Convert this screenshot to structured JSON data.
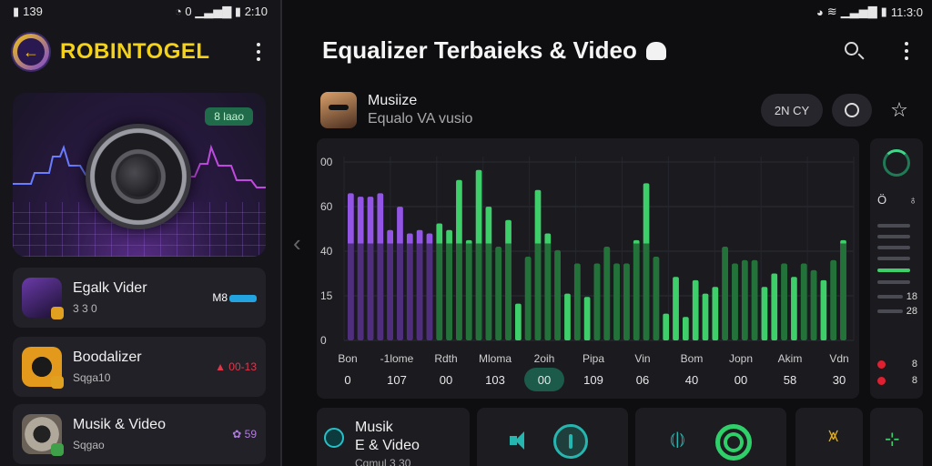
{
  "left": {
    "status": {
      "left_text": "139",
      "right_text": "0",
      "time": "2:10"
    },
    "app_title": "ROBINTOGEL",
    "hero_badge": "8 laao",
    "cards": [
      {
        "title": "Egalk Vider",
        "sub": "3  3  0",
        "meta": "M8",
        "meta_color": "#ffffff"
      },
      {
        "title": "Boodalizer",
        "sub": "Sqga10",
        "meta": "00-13",
        "meta_color": "#e0364a"
      },
      {
        "title": "Musik & Video",
        "sub": "Sqgao",
        "meta": "59",
        "meta_color": "#b07adf"
      }
    ]
  },
  "right": {
    "status": {
      "time": "11:3:0"
    },
    "title": "Equalizer Terbaieks & Video",
    "track": {
      "title": "Musiize",
      "sub": "Equalo VA vusio"
    },
    "pill_label": "2N CY",
    "bottom": {
      "card1_label": "Musik",
      "card1_label2": "E & Video",
      "card1_sub": "Cqmul 3 30"
    }
  },
  "chart_data": {
    "type": "bar",
    "y_ticks": [
      "00",
      "60",
      "40",
      "15",
      "0"
    ],
    "categories": [
      "Bon",
      "-1lome",
      "Rdth",
      "Mloma",
      "2oih",
      "Pipa",
      "Vin",
      "Bom",
      "Jopn",
      "Akim",
      "Vdn"
    ],
    "cat_values": [
      "0",
      "107",
      "00",
      "103",
      "00",
      "109",
      "06",
      "40",
      "00",
      "58",
      "30"
    ],
    "selected_index": 4,
    "series": [
      {
        "values": [
          88,
          86,
          86,
          88,
          66,
          80,
          64,
          66,
          64
        ],
        "color": "#9355e6"
      },
      {
        "values": [
          70,
          66,
          96,
          60,
          102,
          80,
          56,
          72,
          22,
          50,
          90,
          64
        ],
        "color": "#3fcf6a"
      },
      {
        "values": [
          54,
          28,
          46,
          26,
          46,
          56,
          46,
          46,
          60,
          94,
          50,
          16
        ],
        "color": "#3fcf6a"
      },
      {
        "values": [
          38,
          14,
          36,
          28,
          32,
          56,
          46,
          48,
          48,
          32,
          40,
          46
        ],
        "color": "#3fcf6a"
      },
      {
        "values": [
          38,
          46,
          42,
          36,
          48,
          60
        ],
        "color": "#3fcf6a"
      }
    ]
  },
  "side": {
    "icon_row": [
      "Ö",
      "♁"
    ],
    "vals": [
      "18",
      "28"
    ],
    "dots": [
      "8",
      "8"
    ]
  }
}
